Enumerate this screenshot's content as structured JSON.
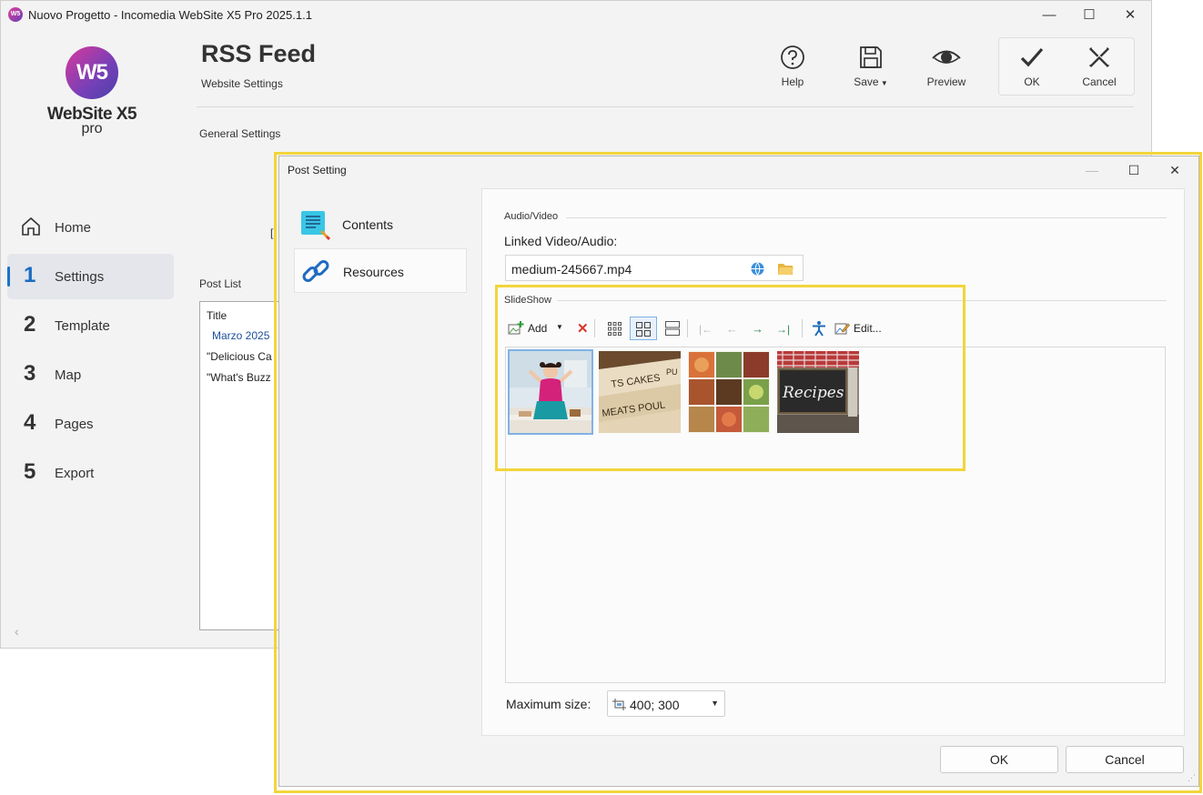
{
  "window": {
    "title": "Nuovo Progetto - Incomedia WebSite X5 Pro 2025.1.1",
    "minimize_icon": "minimize-icon",
    "maximize_icon": "maximize-icon",
    "close_icon": "close-icon"
  },
  "logo": {
    "mark": "W5",
    "name": "WebSite X5",
    "edition": "pro"
  },
  "nav": {
    "items": [
      {
        "num": "",
        "label": "Home"
      },
      {
        "num": "1",
        "label": "Settings"
      },
      {
        "num": "2",
        "label": "Template"
      },
      {
        "num": "3",
        "label": "Map"
      },
      {
        "num": "4",
        "label": "Pages"
      },
      {
        "num": "5",
        "label": "Export"
      }
    ],
    "collapse": "‹"
  },
  "header": {
    "title": "RSS Feed",
    "subtitle": "Website Settings",
    "help": "Help",
    "save": "Save",
    "preview": "Preview",
    "ok": "OK",
    "cancel": "Cancel"
  },
  "main": {
    "general_settings": "General Settings",
    "bracket": "[",
    "post_list_label": "Post List",
    "post_list": {
      "column": "Title",
      "group": "Marzo 2025",
      "rows": [
        "\"Delicious Ca",
        "\"What's Buzz"
      ]
    }
  },
  "dialog": {
    "title": "Post Setting",
    "tabs": [
      {
        "label": "Contents"
      },
      {
        "label": "Resources"
      }
    ],
    "audio_video_section": "Audio/Video",
    "linked_label": "Linked Video/Audio:",
    "linked_value": "medium-245667.mp4",
    "slideshow_section": "SlideShow",
    "toolbar": {
      "add": "Add",
      "edit": "Edit..."
    },
    "thumbnails": [
      {
        "name": "woman-kitchen-photo"
      },
      {
        "name": "recipe-cards-photo"
      },
      {
        "name": "food-collage-photo"
      },
      {
        "name": "recipes-chalkboard-photo",
        "text": "Recipes"
      }
    ],
    "max_size_label": "Maximum size:",
    "max_size_value": "400; 300",
    "ok": "OK",
    "cancel": "Cancel"
  },
  "colors": {
    "accent": "#1a73c8",
    "highlight": "#f2d53c",
    "delete": "#d9342b"
  }
}
